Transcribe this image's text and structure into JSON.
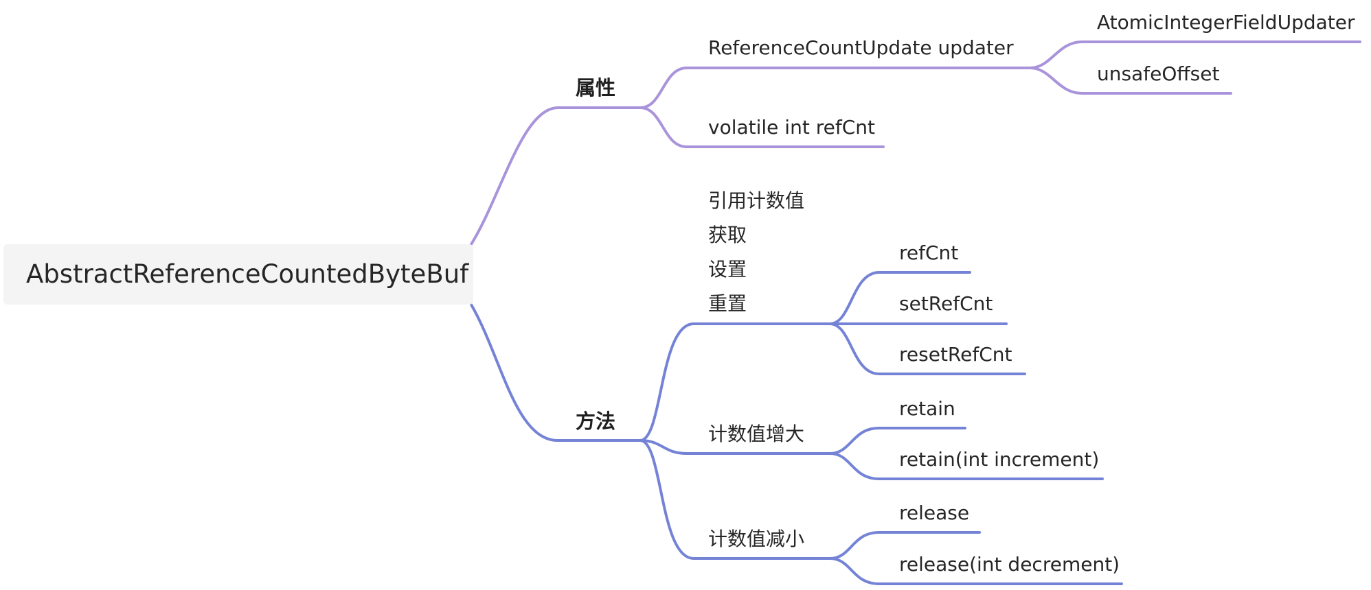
{
  "colors": {
    "attributes_branch": "#a993db",
    "methods_branch": "#7583d6",
    "root_fill": "#f4f4f4",
    "text": "#262626"
  },
  "mindmap": {
    "root": "AbstractReferenceCountedByteBuf",
    "attributes": {
      "label": "属性",
      "updater": {
        "label": "ReferenceCountUpdate updater",
        "children": [
          "AtomicIntegerFieldUpdater",
          "unsafeOffset"
        ]
      },
      "refcnt_field": "volatile int refCnt"
    },
    "methods": {
      "label": "方法",
      "refcnt_ops": {
        "label_lines": [
          "引用计数值",
          "获取",
          "设置",
          "重置"
        ],
        "children": [
          "refCnt",
          "setRefCnt",
          "resetRefCnt"
        ]
      },
      "increase": {
        "label": "计数值增大",
        "children": [
          "retain",
          "retain(int increment)"
        ]
      },
      "decrease": {
        "label": "计数值减小",
        "children": [
          "release",
          "release(int decrement)"
        ]
      }
    }
  }
}
